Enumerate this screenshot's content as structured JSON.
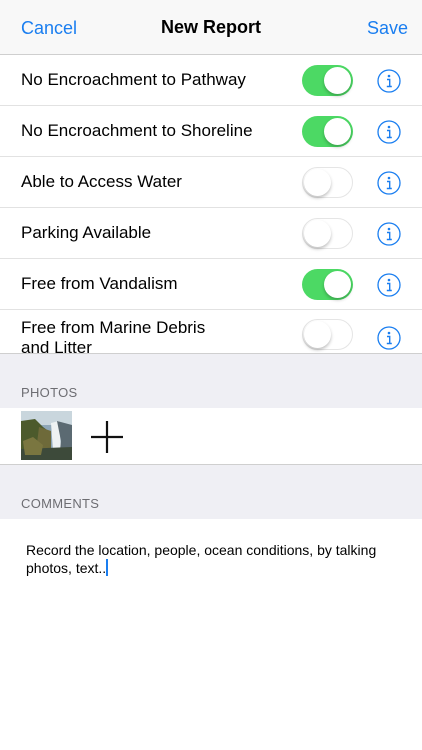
{
  "nav": {
    "cancel": "Cancel",
    "title": "New Report",
    "save": "Save"
  },
  "colors": {
    "accent": "#1a7ef0",
    "toggle_on": "#4cd964"
  },
  "rows": [
    {
      "label": "No Encroachment to Pathway",
      "on": true,
      "icon": "info-icon"
    },
    {
      "label": "No Encroachment to Shoreline",
      "on": true,
      "icon": "info-icon"
    },
    {
      "label": "Able to Access Water",
      "on": false,
      "icon": "info-icon"
    },
    {
      "label": "Parking Available",
      "on": false,
      "icon": "info-icon"
    },
    {
      "label": "Free from Vandalism",
      "on": true,
      "icon": "info-icon"
    },
    {
      "label_line1": "Free from Marine Debris",
      "label_line2": "and Litter",
      "on": false,
      "icon": "info-icon"
    }
  ],
  "photos": {
    "header": "PHOTOS",
    "add_icon": "plus-icon"
  },
  "comments": {
    "header": "COMMENTS",
    "text": "Record the location, people, ocean conditions, by talking photos, text.."
  }
}
